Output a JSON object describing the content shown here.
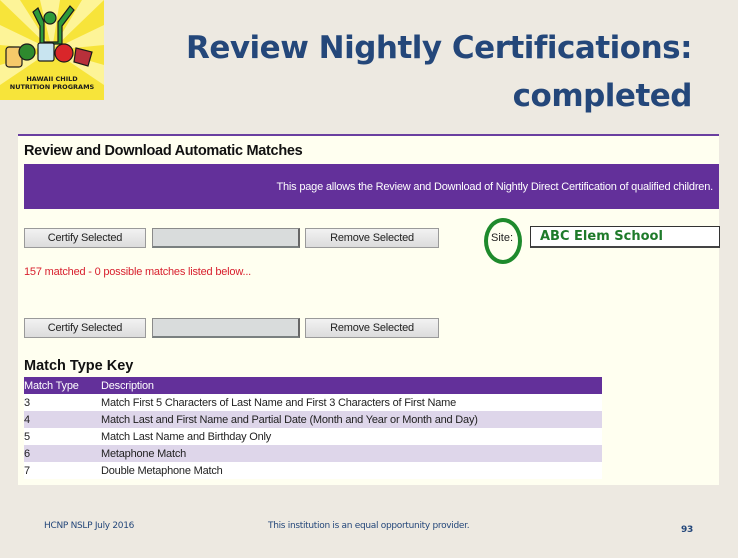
{
  "logo": {
    "line1": "HAWAII CHILD",
    "line2": "NUTRITION PROGRAMS"
  },
  "slide": {
    "title_line1": "Review Nightly Certifications:",
    "title_line2": "completed"
  },
  "screen": {
    "heading": "Review and Download Automatic Matches",
    "banner_text": "This page allows the Review and Download of Nightly Direct Certification of qualified children.",
    "toolbar_top": {
      "certify_label": "Certify Selected",
      "field_value": "",
      "remove_label": "Remove Selected"
    },
    "site": {
      "label": "Site:",
      "value": "ABC Elem School",
      "highlight_color": "#1e8a2c"
    },
    "status_text": "157 matched - 0 possible matches listed below...",
    "toolbar_bottom": {
      "certify_label": "Certify Selected",
      "field_value": "",
      "remove_label": "Remove Selected"
    },
    "key": {
      "heading": "Match Type Key",
      "columns": [
        "Match Type",
        "Description"
      ],
      "rows": [
        {
          "type": "3",
          "description": "Match First 5 Characters of Last Name and First 3 Characters of First Name"
        },
        {
          "type": "4",
          "description": "Match Last and First Name and Partial Date (Month and Year or Month and Day)"
        },
        {
          "type": "5",
          "description": "Match Last Name and Birthday Only"
        },
        {
          "type": "6",
          "description": "Metaphone Match"
        },
        {
          "type": "7",
          "description": "Double Metaphone Match"
        }
      ]
    },
    "colors": {
      "accent_purple": "#63309a",
      "status_red": "#d8202e",
      "row_alt": "#ded6ea"
    }
  },
  "footer": {
    "left": "HCNP NSLP July 2016",
    "center": "This institution is an equal opportunity provider.",
    "page_number": "93"
  }
}
